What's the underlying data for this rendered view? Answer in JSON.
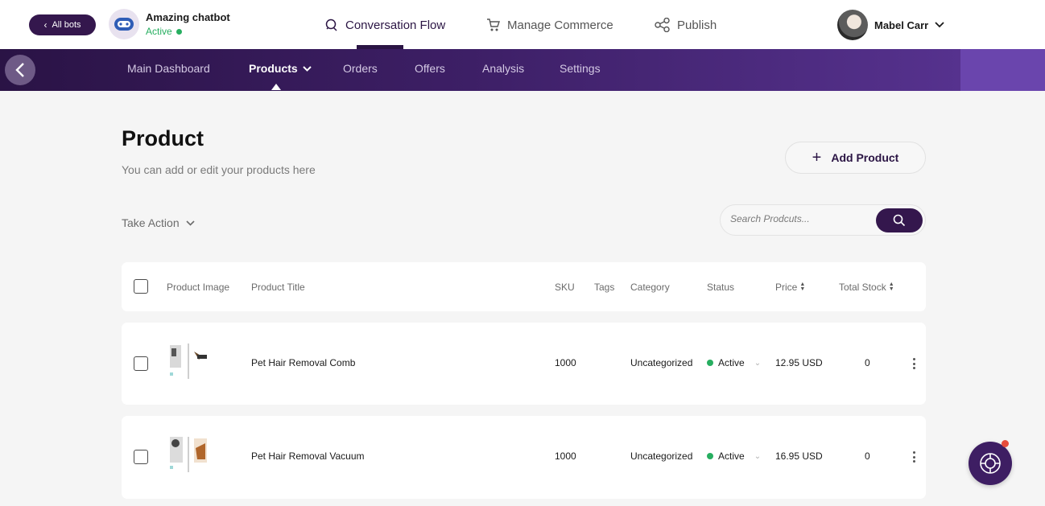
{
  "header": {
    "all_bots_label": "All bots",
    "bot_name": "Amazing chatbot",
    "bot_status": "Active",
    "nav": [
      {
        "label": "Conversation Flow",
        "icon": "chat-flow-icon",
        "active": true
      },
      {
        "label": "Manage Commerce",
        "icon": "cart-icon",
        "active": false
      },
      {
        "label": "Publish",
        "icon": "share-icon",
        "active": false
      }
    ],
    "user_name": "Mabel Carr"
  },
  "subnav": {
    "items": [
      {
        "label": "Main Dashboard"
      },
      {
        "label": "Products"
      },
      {
        "label": "Orders"
      },
      {
        "label": "Offers"
      },
      {
        "label": "Analysis"
      },
      {
        "label": "Settings"
      }
    ],
    "active": "Products"
  },
  "page": {
    "title": "Product",
    "subtitle": "You can add or edit your products here",
    "add_button_label": "Add Product",
    "take_action_label": "Take Action",
    "search_placeholder": "Search Prodcuts..."
  },
  "table": {
    "columns": [
      "Product Image",
      "Product Title",
      "SKU",
      "Tags",
      "Category",
      "Status",
      "Price",
      "Total Stock"
    ],
    "rows": [
      {
        "title": "Pet Hair Removal Comb",
        "sku": "1000",
        "tags": "",
        "category": "Uncategorized",
        "status": "Active",
        "price": "12.95 USD",
        "stock": "0"
      },
      {
        "title": "Pet Hair Removal Vacuum",
        "sku": "1000",
        "tags": "",
        "category": "Uncategorized",
        "status": "Active",
        "price": "16.95 USD",
        "stock": "0"
      }
    ]
  },
  "colors": {
    "brand_dark": "#34174d",
    "status_green": "#27ae60",
    "notification_red": "#e74c3c"
  }
}
